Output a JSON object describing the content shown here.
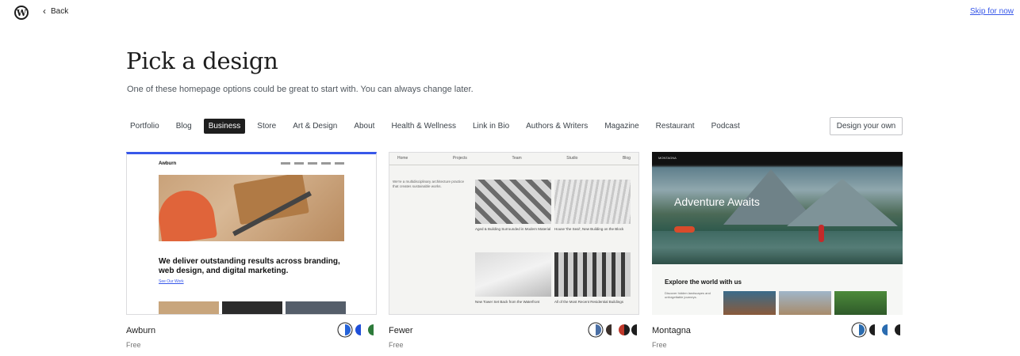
{
  "topbar": {
    "logo_glyph": "W",
    "back_label": "Back",
    "skip_label": "Skip for now"
  },
  "header": {
    "title": "Pick a design",
    "subtitle": "One of these homepage options could be great to start with. You can always change later."
  },
  "categories": [
    {
      "label": "Portfolio",
      "active": false
    },
    {
      "label": "Blog",
      "active": false
    },
    {
      "label": "Business",
      "active": true
    },
    {
      "label": "Store",
      "active": false
    },
    {
      "label": "Art & Design",
      "active": false
    },
    {
      "label": "About",
      "active": false
    },
    {
      "label": "Health & Wellness",
      "active": false
    },
    {
      "label": "Link in Bio",
      "active": false
    },
    {
      "label": "Authors & Writers",
      "active": false
    },
    {
      "label": "Magazine",
      "active": false
    },
    {
      "label": "Restaurant",
      "active": false
    },
    {
      "label": "Podcast",
      "active": false
    }
  ],
  "design_own_label": "Design your own",
  "designs": [
    {
      "name": "Awburn",
      "price": "Free",
      "swatches": [
        [
          "#ffffff",
          "#2563d9"
        ],
        [
          "#1e4fd9",
          "#ffffff"
        ],
        [
          "#2d7a3a",
          "#ffffff"
        ]
      ],
      "preview": {
        "brand": "Awburn",
        "headline": "We deliver outstanding results across branding, web design, and digital marketing.",
        "link": "See Our Work"
      }
    },
    {
      "name": "Fewer",
      "price": "Free",
      "swatches": [
        [
          "#ffffff",
          "#4a6fa5"
        ],
        [
          "#3a2f2a",
          "#ffffff"
        ],
        [
          "#c0392b",
          "#1e1e1e"
        ],
        [
          "#1e1e1e",
          "#ffffff"
        ]
      ],
      "preview": {
        "nav": [
          "Home",
          "Projects",
          "Team",
          "Studio",
          "Blog"
        ],
        "description": "We're a multidisciplinary architecture practice that creates sustainable works.",
        "captions": [
          "Aged & Building Surrounded in Modern Material",
          "House 'the Seal', New Building on the Block",
          "New Tower Set Back from the Waterfront",
          "All of the Most Recent Residential Buildings"
        ]
      }
    },
    {
      "name": "Montagna",
      "price": "Free",
      "swatches": [
        [
          "#ffffff",
          "#2b6cb0"
        ],
        [
          "#1e1e1e",
          "#ffffff"
        ],
        [
          "#2b6cb0",
          "#ffffff"
        ],
        [
          "#1e1e1e",
          "#ffffff"
        ]
      ],
      "preview": {
        "brand": "MONTAGNA",
        "hero_title": "Adventure Awaits",
        "section_title": "Explore the world with us",
        "section_text": "Discover hidden landscapes and unforgettable journeys."
      }
    }
  ]
}
